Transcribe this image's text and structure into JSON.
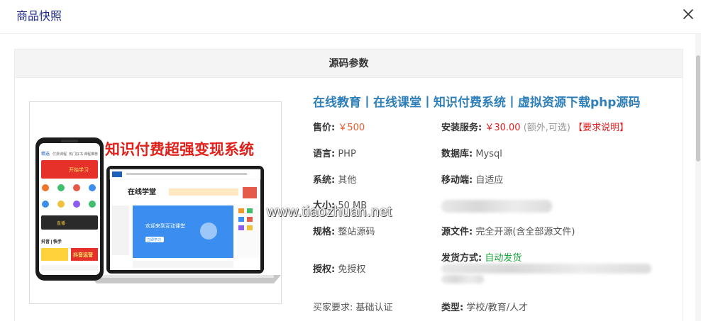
{
  "dialog": {
    "title": "商品快照"
  },
  "panel": {
    "header": "源码参数"
  },
  "product": {
    "title": "在线教育丨在线课堂丨知识付费系统丨虚拟资源下载php源码",
    "image": {
      "headline": "知识付费超强变现系统",
      "phone_tabs": [
        "精选",
        "付费课程",
        "热门好书",
        "课程推荐"
      ],
      "phone_banner": "开始学习",
      "phone_live": "直播",
      "phone_notice": "抖音 | 快手",
      "phone_promo": "抖音运营",
      "site_brand": "在线学堂",
      "site_banner": "欢迎来到互动课堂",
      "site_cta": "立即学习"
    }
  },
  "specs": {
    "price_label": "售价:",
    "price_value": "￥500",
    "install_label": "安装服务:",
    "install_value": "￥30.00",
    "install_note": "(额外,可选)",
    "install_link": "【要求说明】",
    "lang_label": "语言:",
    "lang_value": "PHP",
    "db_label": "数据库:",
    "db_value": "Mysql",
    "sys_label": "系统:",
    "sys_value": "其他",
    "mobile_label": "移动端:",
    "mobile_value": "自适应",
    "size_label": "大小:",
    "size_value": "50 MB",
    "norm_label": "规格:",
    "norm_value": "整站源码",
    "src_label": "源文件:",
    "src_value": "完全开源(含全部源文件)",
    "ship_label": "发货方式:",
    "ship_value": "自动发货",
    "auth_label": "授权:",
    "auth_value": "免授权",
    "buyer_label": "买家要求:",
    "buyer_value": "基础认证",
    "type_label": "类型:",
    "type_value": "学校/教育/人才"
  },
  "watermark": "www.tiaozhuan.net",
  "colors": {
    "title_blue": "#2f7fb8",
    "dialog_title": "#1f2a86",
    "price": "#e55b2c",
    "red": "#e02020",
    "green": "#1aa33a"
  }
}
